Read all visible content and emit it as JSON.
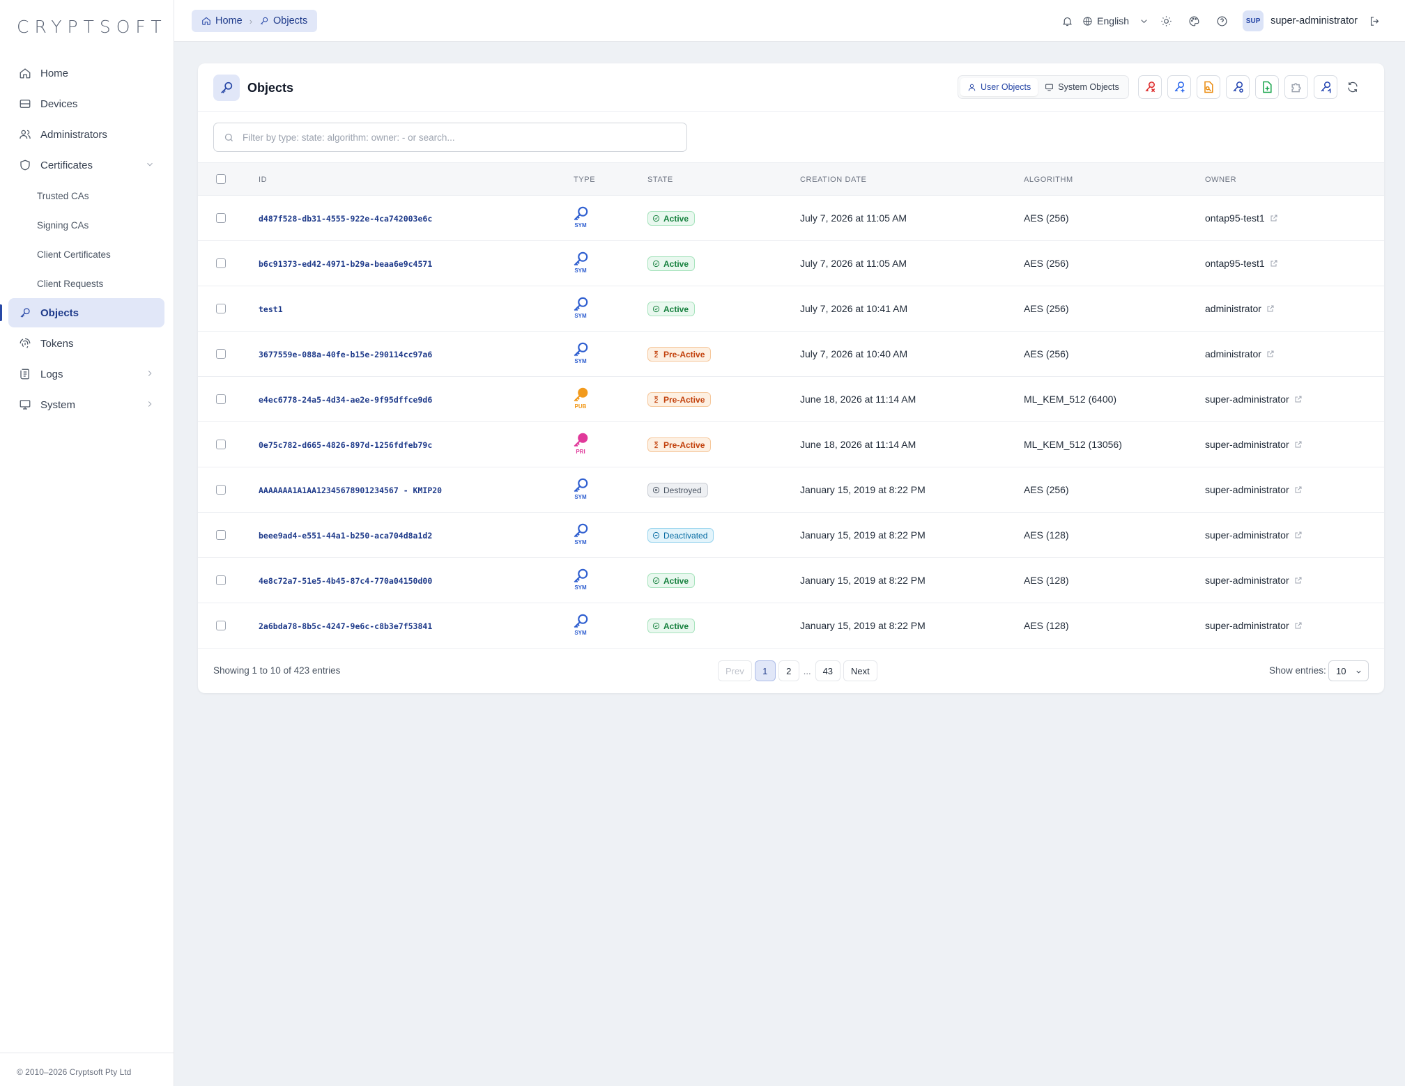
{
  "brand": "CRYPTSOFT",
  "copyright": "© 2010–2026 Cryptsoft Pty Ltd",
  "sidebar": {
    "home": "Home",
    "devices": "Devices",
    "administrators": "Administrators",
    "certificates": "Certificates",
    "sub": [
      "Trusted CAs",
      "Signing CAs",
      "Client Certificates",
      "Client Requests"
    ],
    "objects": "Objects",
    "tokens": "Tokens",
    "logs": "Logs",
    "system": "System"
  },
  "breadcrumb": {
    "home": "Home",
    "current": "Objects"
  },
  "topbar": {
    "language": "English",
    "avatar": "SUP",
    "user": "super-administrator"
  },
  "page": {
    "title": "Objects",
    "user_objects": "User Objects",
    "system_objects": "System Objects",
    "search_placeholder": "Filter by type: state: algorithm: owner: - or search..."
  },
  "columns": {
    "id": "ID",
    "type": "TYPE",
    "state": "STATE",
    "date": "CREATION DATE",
    "algorithm": "ALGORITHM",
    "owner": "OWNER"
  },
  "rows": [
    {
      "id": "d487f528-db31-4555-922e-4ca742003e6c",
      "type": "SYM",
      "state": "Active",
      "date": "July 7, 2026 at 11:05 AM",
      "algorithm": "AES (256)",
      "owner": "ontap95-test1"
    },
    {
      "id": "b6c91373-ed42-4971-b29a-beaa6e9c4571",
      "type": "SYM",
      "state": "Active",
      "date": "July 7, 2026 at 11:05 AM",
      "algorithm": "AES (256)",
      "owner": "ontap95-test1"
    },
    {
      "id": "test1",
      "type": "SYM",
      "state": "Active",
      "date": "July 7, 2026 at 10:41 AM",
      "algorithm": "AES (256)",
      "owner": "administrator"
    },
    {
      "id": "3677559e-088a-40fe-b15e-290114cc97a6",
      "type": "SYM",
      "state": "Pre-Active",
      "date": "July 7, 2026 at 10:40 AM",
      "algorithm": "AES (256)",
      "owner": "administrator"
    },
    {
      "id": "e4ec6778-24a5-4d34-ae2e-9f95dffce9d6",
      "type": "PUB",
      "state": "Pre-Active",
      "date": "June 18, 2026 at 11:14 AM",
      "algorithm": "ML_KEM_512 (6400)",
      "owner": "super-administrator"
    },
    {
      "id": "0e75c782-d665-4826-897d-1256fdfeb79c",
      "type": "PRI",
      "state": "Pre-Active",
      "date": "June 18, 2026 at 11:14 AM",
      "algorithm": "ML_KEM_512 (13056)",
      "owner": "super-administrator"
    },
    {
      "id": "AAAAAAA1A1AA12345678901234567 - KMIP20",
      "type": "SYM",
      "state": "Destroyed",
      "date": "January 15, 2019 at 8:22 PM",
      "algorithm": "AES (256)",
      "owner": "super-administrator"
    },
    {
      "id": "beee9ad4-e551-44a1-b250-aca704d8a1d2",
      "type": "SYM",
      "state": "Deactivated",
      "date": "January 15, 2019 at 8:22 PM",
      "algorithm": "AES (128)",
      "owner": "super-administrator"
    },
    {
      "id": "4e8c72a7-51e5-4b45-87c4-770a04150d00",
      "type": "SYM",
      "state": "Active",
      "date": "January 15, 2019 at 8:22 PM",
      "algorithm": "AES (128)",
      "owner": "super-administrator"
    },
    {
      "id": "2a6bda78-8b5c-4247-9e6c-c8b3e7f53841",
      "type": "SYM",
      "state": "Active",
      "date": "January 15, 2019 at 8:22 PM",
      "algorithm": "AES (128)",
      "owner": "super-administrator"
    }
  ],
  "footer": {
    "showing": "Showing 1 to 10 of 423 entries",
    "prev": "Prev",
    "p1": "1",
    "p2": "2",
    "ellipsis": "...",
    "last": "43",
    "next": "Next",
    "show_entries": "Show entries:",
    "entries_value": "10"
  },
  "colors": {
    "accent": "#2747a6",
    "sym": "#2f5fd0",
    "pub": "#f29a1c",
    "pri": "#e0399a"
  }
}
